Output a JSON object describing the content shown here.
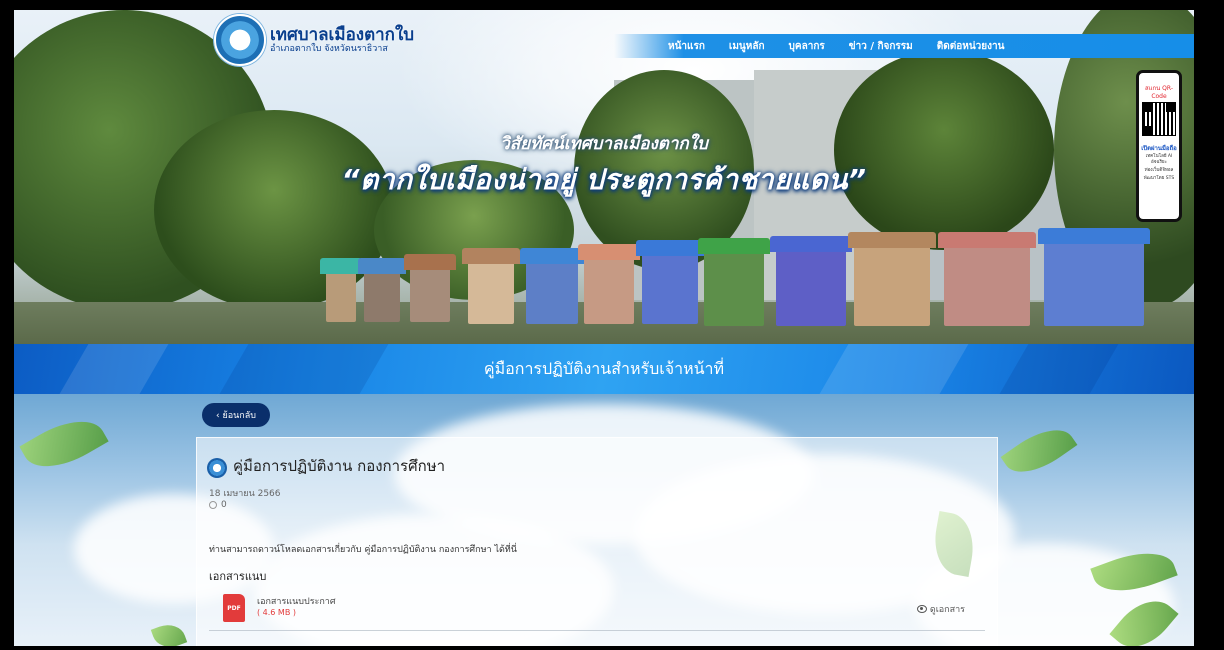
{
  "header": {
    "site_name": "เทศบาลเมืองตากใบ",
    "site_sub": "อำเภอตากใบ จังหวัดนราธิวาส",
    "nav": [
      "หน้าแรก",
      "เมนูหลัก",
      "บุคลากร",
      "ข่าว / กิจกรรม",
      "ติดต่อหน่วยงาน"
    ]
  },
  "hero": {
    "vision_label": "วิสัยทัศน์เทศบาลเมืองตากใบ",
    "slogan": "“ตากใบเมืองน่าอยู่ ประตูการค้าชายแดน”"
  },
  "qr_card": {
    "label": "สแกน QR-Code",
    "caption": "เปิดผ่านมือถือ",
    "sub1": "เทคโนโลยี AI อัจฉริยะ",
    "sub2": "ท่องเว็บดิจิทอล",
    "sub3": "พัฒนาโดย STS"
  },
  "page": {
    "title": "คู่มือการปฏิบัติงานสำหรับเจ้าหน้าที่",
    "back_label": "‹ ย้อนกลับ"
  },
  "document": {
    "title": "คู่มือการปฏิบัติงาน กองการศึกษา",
    "date": "18 เมษายน 2566",
    "views": "0",
    "description": "ท่านสามารถดาวน์โหลดเอกสารเกี่ยวกับ คู่มือการปฏิบัติงาน กองการศึกษา ได้ที่นี่",
    "attachments_heading": "เอกสารแนบ",
    "attachments": [
      {
        "icon_text": "PDF",
        "name": "เอกสารแนบประกาศ",
        "size": "( 4.6 MB )",
        "view_label": "ดูเอกสาร"
      }
    ]
  }
}
